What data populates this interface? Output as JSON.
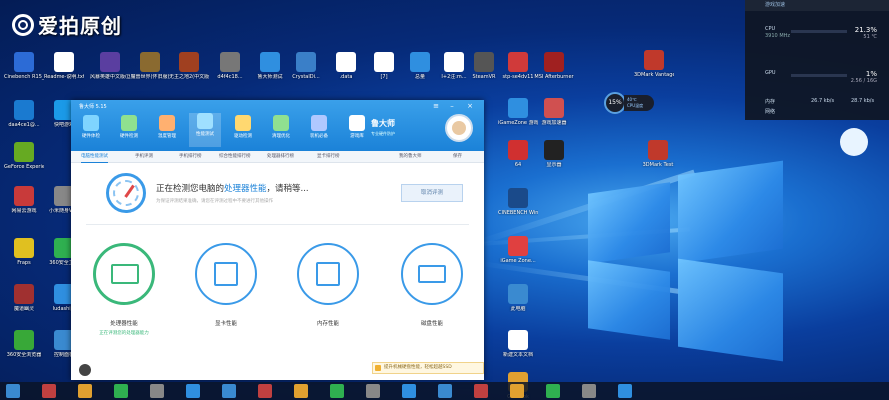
{
  "watermark": {
    "text": "爱拍原创"
  },
  "desktop_icons": [
    {
      "label": "Cinebench R15_18@...",
      "color": "#2c6bd6"
    },
    {
      "label": "Readme-说明.txt",
      "color": "#ffffff"
    },
    {
      "label": "风暴英雄中文版(国服)",
      "color": "#5a3ea0"
    },
    {
      "label": "魔兽世界(怀旧服)",
      "color": "#8a6a30"
    },
    {
      "label": "无主之地2(中文版)",
      "color": "#a04020"
    },
    {
      "label": "d4f4c18...",
      "color": "#777777"
    },
    {
      "label": "鲁大师测试",
      "color": "#2f8fe0"
    },
    {
      "label": "CrystalDi...",
      "color": "#3a7fc8"
    },
    {
      "label": ".data",
      "color": "#ffffff"
    },
    {
      "label": "[7]",
      "color": "#ffffff"
    },
    {
      "label": "总量",
      "color": "#2f8fe0"
    },
    {
      "label": "I+2注:m...",
      "color": "#ffffff"
    },
    {
      "label": "SteamVR",
      "color": "#555555"
    },
    {
      "label": "stp-se4dv11",
      "color": "#d03a3a"
    },
    {
      "label": "MSI Afterburner",
      "color": "#a02020"
    },
    {
      "label": "daa4ce1@...",
      "color": "#1a7ad0"
    },
    {
      "label": "快吧游戏",
      "color": "#1b9ae8"
    },
    {
      "label": "GeForce Experience",
      "color": "#66aa22"
    },
    {
      "label": "网易云游戏",
      "color": "#c83a3a"
    },
    {
      "label": "小米随身WiFi",
      "color": "#888888"
    },
    {
      "label": "Fraps",
      "color": "#e0c020"
    },
    {
      "label": "360安全卫士",
      "color": "#2fb050"
    },
    {
      "label": "魔道幽灵",
      "color": "#a03030"
    },
    {
      "label": "ludashijh",
      "color": "#2f8fe0"
    },
    {
      "label": "360安全浏览器",
      "color": "#38a838"
    },
    {
      "label": "控制面板",
      "color": "#3a8ad0"
    },
    {
      "label": "iGameZone 游戏服务",
      "color": "#2f8fe0"
    },
    {
      "label": "游戏加速器",
      "color": "#d05050"
    },
    {
      "label": "3DMark Vantage",
      "color": "#c0392b"
    },
    {
      "label": "64",
      "color": "#d03030"
    },
    {
      "label": "显示器",
      "color": "#222222"
    },
    {
      "label": "CINEBENCH Windows 6...",
      "color": "#1a4a8a"
    },
    {
      "label": "iGame Zone...",
      "color": "#e04040"
    },
    {
      "label": "此电脑",
      "color": "#3a8ad0"
    },
    {
      "label": "新建文本文档",
      "color": "#ffffff"
    },
    {
      "label": "Gasbook",
      "color": "#e0a030"
    },
    {
      "label": "3DMark Test",
      "color": "#c0392b"
    }
  ],
  "perf_widget": {
    "header": "游戏加速",
    "rows": [
      {
        "key": "CPU",
        "sub": "3910 MHz",
        "value": "21.3",
        "unit": "%",
        "value2": "51 ℃"
      },
      {
        "key": "GPU",
        "sub": "",
        "value": "1",
        "unit": "%",
        "value2": "2.56 / 16G"
      },
      {
        "key": "内存",
        "sub": "",
        "value": "",
        "unit": "",
        "value2": "26.7 kb/s"
      },
      {
        "key": "网络",
        "sub": "",
        "value": "",
        "unit": "",
        "value2": "28.7 kb/s"
      }
    ]
  },
  "floating_ball": {
    "percent": "15%",
    "temp": "40℃",
    "label": "CPU温度"
  },
  "app": {
    "title": "鲁大师 5.15",
    "nav": [
      {
        "label": "硬件体检",
        "color": "#7fd4ff"
      },
      {
        "label": "硬件检测",
        "color": "#8fe08f"
      },
      {
        "label": "温度管理",
        "color": "#ffb070"
      },
      {
        "label": "性能测试",
        "color": "#9fe0ff"
      },
      {
        "label": "驱动检测",
        "color": "#ffd870"
      },
      {
        "label": "清理优化",
        "color": "#90e090"
      },
      {
        "label": "装机必备",
        "color": "#b0c8ff"
      },
      {
        "label": "游戏库",
        "color": "#ffffff"
      }
    ],
    "brand_name": "鲁大师",
    "brand_slogan": "专业硬件防护",
    "subtabs": [
      "电脑性能测试",
      "手机评测",
      "手机排行榜",
      "综合性能排行榜",
      "处理器排行榜",
      "显卡排行榜"
    ],
    "actions": [
      "我的鲁大师",
      "保存"
    ],
    "status_prefix": "正在检测您电脑的",
    "status_highlight": "处理器性能",
    "status_suffix": "，请稍等...",
    "substatus": "为保证评测结果准确，请您在评测过程中不要进行其他操作",
    "cancel_label": "取消评测",
    "cards": [
      {
        "label": "处理器性能",
        "sub": "正在评测您的处理器能力",
        "state": "active"
      },
      {
        "label": "显卡性能",
        "sub": "",
        "state": "pending"
      },
      {
        "label": "内存性能",
        "sub": "",
        "state": "pending"
      },
      {
        "label": "磁盘性能",
        "sub": "",
        "state": "pending"
      }
    ],
    "bottom_hint": "提升机械硬盘性能，轻松超越SSD"
  }
}
